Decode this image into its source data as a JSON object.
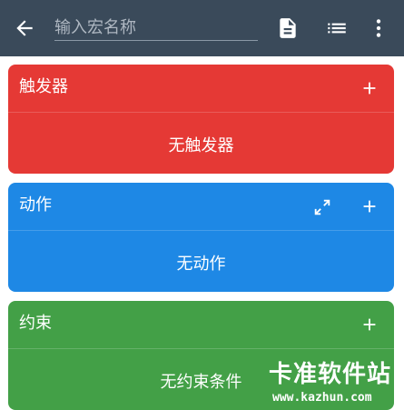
{
  "header": {
    "name_input_placeholder": "输入宏名称",
    "name_input_value": ""
  },
  "icons": {
    "back": "arrow-left-icon",
    "doc": "document-icon",
    "list": "list-icon",
    "more": "more-vertical-icon",
    "add": "plus-icon",
    "expand": "expand-icon"
  },
  "colors": {
    "topbar": "#3a4a5a",
    "trigger": "#e53935",
    "action": "#1e88e5",
    "constraint": "#43a047"
  },
  "cards": {
    "trigger": {
      "title": "触发器",
      "empty_text": "无触发器"
    },
    "action": {
      "title": "动作",
      "empty_text": "无动作"
    },
    "constraint": {
      "title": "约束",
      "empty_text": "无约束条件"
    }
  },
  "watermark": {
    "title": "卡准软件站",
    "url": "www.kazhun.com"
  }
}
